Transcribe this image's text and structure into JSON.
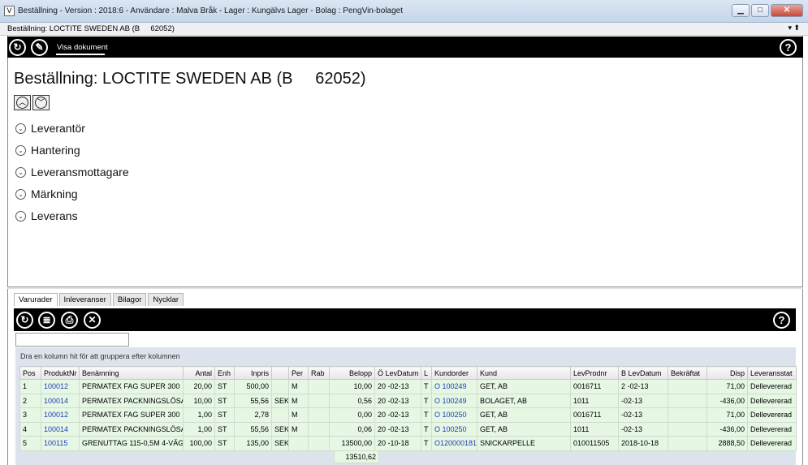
{
  "window": {
    "title": "Beställning - Version : 2018:6 - Användare : Malva Bråk - Lager : Kungälvs Lager  - Bolag : PengVin-bolaget",
    "app_icon": "V",
    "buttons": {
      "minimize": "▁",
      "maximize": "□",
      "close": "✕"
    }
  },
  "doc_tab": {
    "label": "Beställning: LOCTITE SWEDEN AB (B     62052)",
    "pin": "▾  ⬆"
  },
  "toolbar": {
    "refresh_icon": "↻",
    "pin_icon": "✎",
    "visa_dokument": "Visa dokument",
    "help": "?"
  },
  "header": {
    "title": "Beställning: LOCTITE SWEDEN AB (B     62052)",
    "up": "︿",
    "down": "﹀"
  },
  "sections": [
    "Leverantör",
    "Hantering",
    "Leveransmottagare",
    "Märkning",
    "Leverans"
  ],
  "subtabs": [
    "Varurader",
    "Inleveranser",
    "Bilagor",
    "Nycklar"
  ],
  "grid_toolbar": {
    "refresh": "↻",
    "list": "≣",
    "print": "⎙",
    "cancel": "✕",
    "help": "?"
  },
  "grid": {
    "group_hint": "Dra en kolumn hit för att gruppera efter kolumnen",
    "columns": [
      "Pos",
      "ProduktNr",
      "Benämning",
      "Antal",
      "Enh",
      "Inpris",
      "",
      "Per",
      "Rab",
      "Belopp",
      "Ö LevDatum",
      "L",
      "Kundorder",
      "Kund",
      "LevProdnr",
      "B LevDatum",
      "Bekräftat",
      "Disp",
      "Leveransstat"
    ],
    "rows": [
      [
        "1",
        "100012",
        "PERMATEX FAG SUPER 300",
        "20,00",
        "ST",
        "500,00",
        "",
        "M",
        "",
        "10,00",
        "20   -02-13",
        "T",
        "O  100249",
        "GET, AB",
        "0016711",
        "2    -02-13",
        "",
        "71,00",
        "Dellevererad"
      ],
      [
        "2",
        "100014",
        "PERMATEX PACKNINGSLÖSARE",
        "10,00",
        "ST",
        "55,56",
        "SEK",
        "M",
        "",
        "0,56",
        "20   -02-13",
        "T",
        "O  100249",
        "ΒOLAGET, AB",
        "1011",
        "     -02-13",
        "",
        "-436,00",
        "Dellevererad"
      ],
      [
        "3",
        "100012",
        "PERMATEX FAG SUPER 300",
        "1,00",
        "ST",
        "2,78",
        "",
        "M",
        "",
        "0,00",
        "20   -02-13",
        "T",
        "O  100250",
        "GET, AB",
        "0016711",
        "     -02-13",
        "",
        "71,00",
        "Dellevererad"
      ],
      [
        "4",
        "100014",
        "PERMATEX PACKNINGSLÖSARE",
        "1,00",
        "ST",
        "55,56",
        "SEK",
        "M",
        "",
        "0,06",
        "20   -02-13",
        "T",
        "O  100250",
        "GET, AB",
        "1011",
        "     -02-13",
        "",
        "-436,00",
        "Dellevererad"
      ],
      [
        "5",
        "100115",
        "GRENUTTAG 115-0,5M 4-VÄG",
        "100,00",
        "ST",
        "135,00",
        "SEK",
        "",
        "",
        "13500,00",
        "20   -10-18",
        "T",
        "O120000181",
        "SNICKARPELLE",
        "010011505",
        "2018-10-18",
        "",
        "2888,50",
        "Dellevererad"
      ]
    ],
    "total": "13510,62"
  }
}
